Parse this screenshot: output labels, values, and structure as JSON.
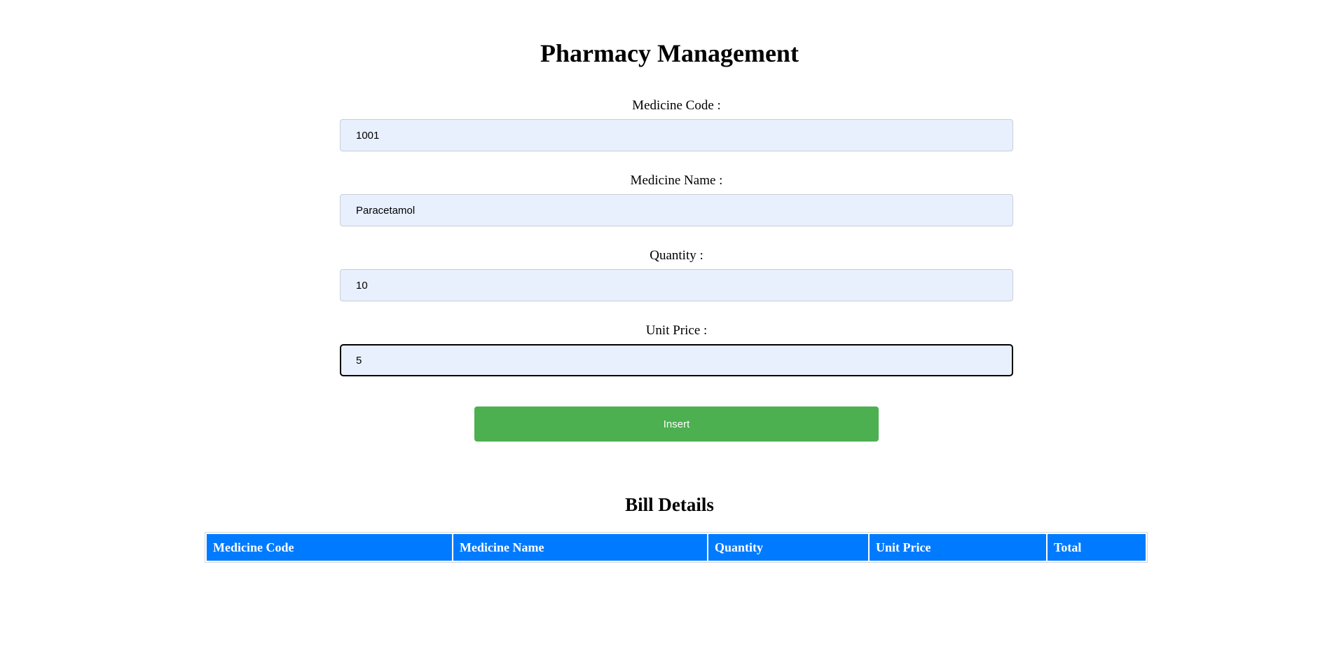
{
  "page": {
    "title": "Pharmacy Management"
  },
  "form": {
    "medicine_code": {
      "label": "Medicine Code :",
      "value": "1001"
    },
    "medicine_name": {
      "label": "Medicine Name :",
      "value": "Paracetamol"
    },
    "quantity": {
      "label": "Quantity :",
      "value": "10"
    },
    "unit_price": {
      "label": "Unit Price :",
      "value": "5"
    },
    "insert_label": "Insert"
  },
  "bill": {
    "title": "Bill Details",
    "columns": [
      "Medicine Code",
      "Medicine Name",
      "Quantity",
      "Unit Price",
      "Total"
    ]
  },
  "colors": {
    "input_bg": "#e8f0fe",
    "button_bg": "#4caf50",
    "table_header_bg": "#007bff"
  }
}
